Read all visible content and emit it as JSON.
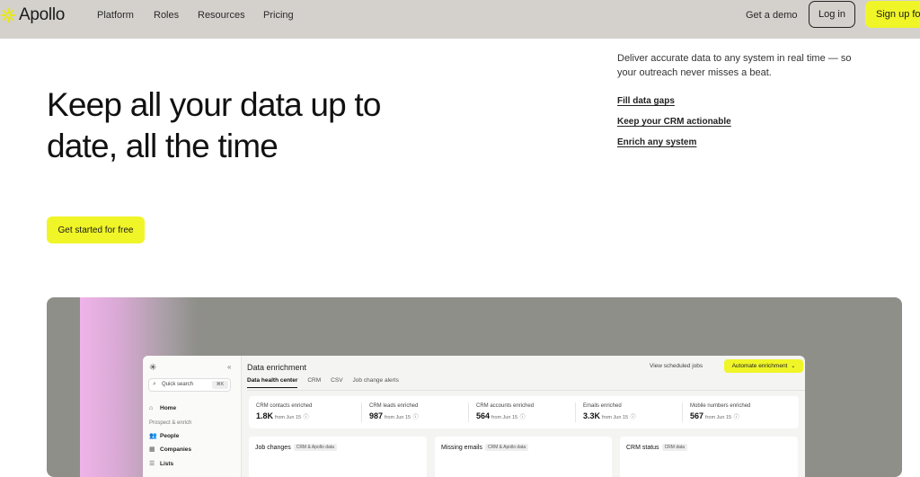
{
  "brand": {
    "name": "Apollo",
    "accent": "#f0f527",
    "nav_bg": "#d4d1cd"
  },
  "nav": {
    "links": [
      "Platform",
      "Roles",
      "Resources",
      "Pricing"
    ],
    "demo": "Get a demo",
    "login": "Log in",
    "signup": "Sign up for"
  },
  "hero": {
    "title": "Keep all your data up to date, all the time",
    "description": "Deliver accurate data to any system in real time — so your outreach never misses a beat.",
    "links": [
      "Fill data gaps",
      "Keep your CRM actionable",
      "Enrich any system"
    ],
    "cta": "Get started for free"
  },
  "app": {
    "sidebar": {
      "search_placeholder": "Quick search",
      "search_shortcut": "⌘K",
      "home": "Home",
      "section": "Prospect & enrich",
      "items": [
        "People",
        "Companies",
        "Lists"
      ]
    },
    "title": "Data enrichment",
    "tabs": [
      "Data health center",
      "CRM",
      "CSV",
      "Job change alerts"
    ],
    "active_tab": "Data health center",
    "scheduled": "View scheduled jobs",
    "automate": "Automate enrichment",
    "stats": [
      {
        "label": "CRM contacts enriched",
        "value": "1.8K",
        "from": "from Jun 15"
      },
      {
        "label": "CRM leads enriched",
        "value": "987",
        "from": "from Jun 15"
      },
      {
        "label": "CRM accounts enriched",
        "value": "564",
        "from": "from Jun 15"
      },
      {
        "label": "Emails enriched",
        "value": "3.3K",
        "from": "from Jun 15"
      },
      {
        "label": "Mobile numbers enriched",
        "value": "567",
        "from": "from Jun 15"
      }
    ],
    "panels": [
      {
        "title": "Job changes",
        "badge": "CRM & Apollo data"
      },
      {
        "title": "Missing emails",
        "badge": "CRM & Apollo data"
      },
      {
        "title": "CRM status",
        "badge": "CRM data"
      }
    ]
  }
}
